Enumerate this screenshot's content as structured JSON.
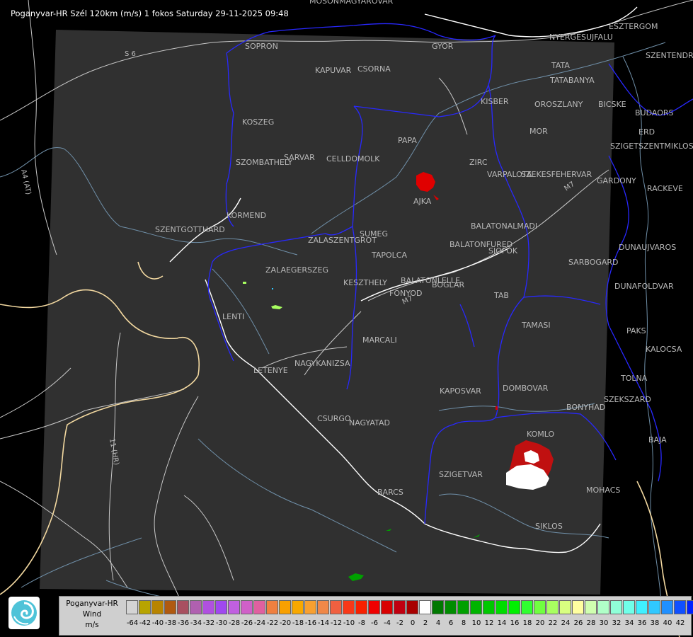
{
  "title": "Poganyvar-HR Szél 120km (m/s) 1 fokos Saturday 29-11-2025 09:48",
  "colors": {
    "background": "#000000",
    "coverage_area": "#303030",
    "border_white": "#ffffff",
    "county_blue": "#1a1aff",
    "river": "#6f8fa8",
    "road": "#c8c8c8",
    "hr_border": "#f2d8a0",
    "label": "#b9b9b9"
  },
  "road_labels": [
    "S 6",
    "A4 (AT)",
    "11 (HR)",
    "M7",
    "M7"
  ],
  "cities": [
    "MOSONMAGYAROVAR",
    "ESZTERGOM",
    "SOPRON",
    "GYOR",
    "NYERGESUJFALU",
    "SZENTENDRE",
    "KAPUVAR",
    "CSORNA",
    "TATA",
    "TATABANYA",
    "KISBER",
    "OROSZLANY",
    "BICSKE",
    "BUDAORS",
    "KOSZEG",
    "PAPA",
    "MOR",
    "ERD",
    "SZIGETSZENTMIKLOS",
    "SZOMBATHELY",
    "SARVAR",
    "CELLDOMOLK",
    "ZIRC",
    "VARPALOTA",
    "SZEKESFEHERVAR",
    "GARDONY",
    "RACKEVE",
    "AJKA",
    "KORMEND",
    "SZENTGOTTHARD",
    "SUMEG",
    "BALATONALMADI",
    "ZALASZENTGROT",
    "TAPOLCA",
    "BALATONFURED",
    "SIOFOK",
    "DUNAUJVAROS",
    "ZALAEGERSZEG",
    "SARBOGARD",
    "KESZTHELY",
    "BALATONLELLE",
    "FONYOD",
    "BOGLAR",
    "DUNAFOLDVAR",
    "TAB",
    "LENTI",
    "TAMASI",
    "PAKS",
    "MARCALI",
    "KALOCSA",
    "LETENYE",
    "NAGYKANIZSA",
    "KAPOSVAR",
    "DOMBOVAR",
    "TOLNA",
    "SZEKSZARD",
    "BONYHAD",
    "CSURGO",
    "NAGYATAD",
    "KOMLO",
    "BAJA",
    "SZIGETVAR",
    "MOHACS",
    "BARCS",
    "SIKLOS"
  ],
  "legend": {
    "label_lines": [
      "Poganyvar-HR",
      "Wind",
      "m/s"
    ],
    "ticks": [
      "-64",
      "-42",
      "-40",
      "-38",
      "-36",
      "-34",
      "-32",
      "-30",
      "-28",
      "-26",
      "-24",
      "-22",
      "-20",
      "-18",
      "-16",
      "-14",
      "-12",
      "-10",
      "-8",
      "-6",
      "-4",
      "-2",
      "0",
      "2",
      "4",
      "6",
      "8",
      "10",
      "12",
      "14",
      "16",
      "18",
      "20",
      "22",
      "24",
      "26",
      "28",
      "30",
      "32",
      "34",
      "36",
      "38",
      "40",
      "42"
    ],
    "swatches": [
      "#d4d4d4",
      "#b8a400",
      "#b88400",
      "#b05a10",
      "#a85060",
      "#b060b0",
      "#b050e0",
      "#a048f0",
      "#c060e0",
      "#d060c8",
      "#e060a0",
      "#f08040",
      "#f8a000",
      "#f8a800",
      "#f8a030",
      "#f08848",
      "#f06040",
      "#f83818",
      "#f82000",
      "#f00000",
      "#d80000",
      "#c00010",
      "#a80000",
      "#ffffff",
      "#007800",
      "#008c00",
      "#00a000",
      "#00b400",
      "#00c800",
      "#00dc00",
      "#00f000",
      "#30ff30",
      "#70ff40",
      "#a8ff60",
      "#d8ff80",
      "#ffffa0",
      "#d0ffb0",
      "#b0ffc8",
      "#90ffd8",
      "#70ffe8",
      "#40f0ff",
      "#30c8ff",
      "#2090ff",
      "#1050ff",
      "#0020ff"
    ]
  }
}
